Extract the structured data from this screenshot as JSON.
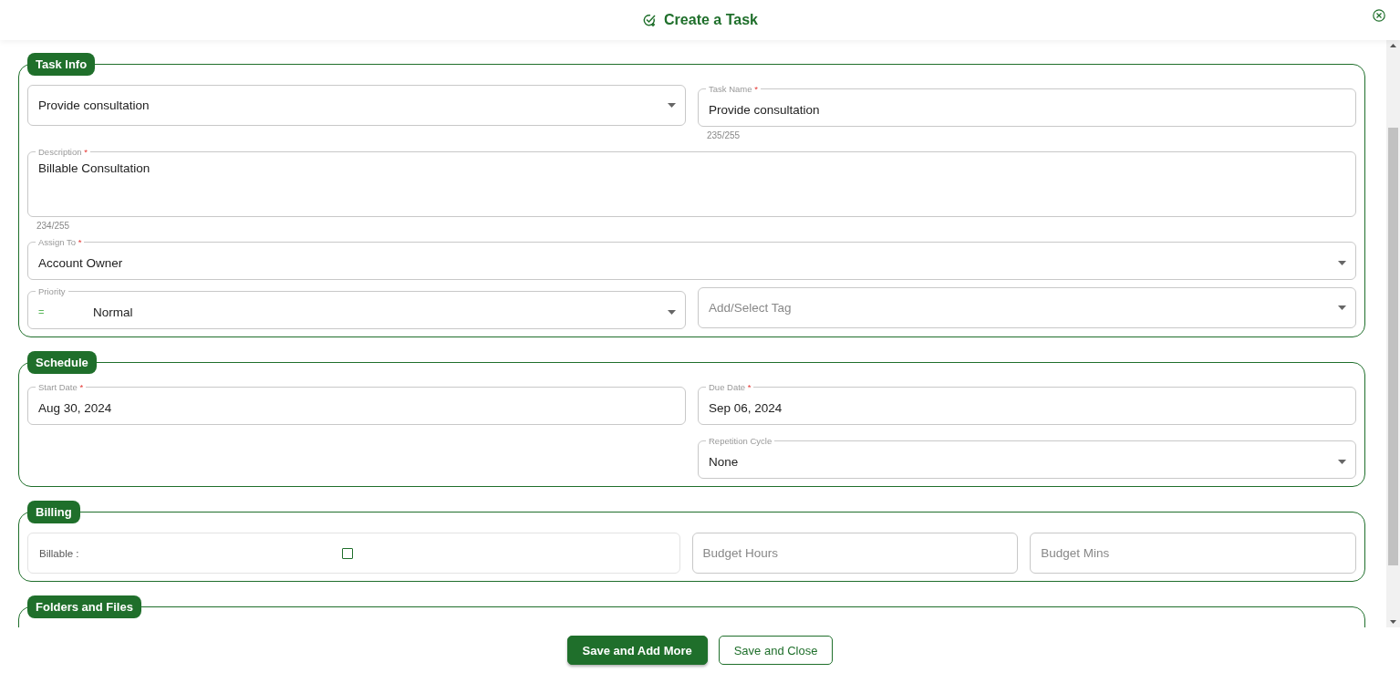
{
  "header": {
    "title": "Create a Task"
  },
  "sections": [
    {
      "title": "Task Info",
      "rows": [
        {
          "fields": [
            {
              "kind": "select",
              "value": "Provide consultation"
            },
            {
              "kind": "text",
              "label": "Task Name",
              "required_mark": "*",
              "value": "Provide consultation",
              "helper": "235/255"
            }
          ]
        },
        {
          "fields": [
            {
              "kind": "textarea",
              "label": "Description",
              "required_mark": "*",
              "value": "Billable Consultation",
              "helper": "234/255"
            }
          ]
        },
        {
          "fields": [
            {
              "kind": "select",
              "label": "Assign To",
              "required_mark": "*",
              "value": "Account Owner"
            }
          ]
        },
        {
          "fields": [
            {
              "kind": "select",
              "label": "Priority",
              "icon": "=",
              "value": "Normal"
            },
            {
              "kind": "select",
              "placeholder": "Add/Select Tag"
            }
          ]
        }
      ]
    },
    {
      "title": "Schedule",
      "columns": [
        [
          {
            "kind": "text",
            "label": "Start Date",
            "required_mark": "*",
            "value": "Aug 30, 2024"
          }
        ],
        [
          {
            "kind": "text",
            "label": "Due Date",
            "required_mark": "*",
            "value": "Sep 06, 2024"
          },
          {
            "kind": "select",
            "label": "Repetition Cycle",
            "value": "None"
          }
        ]
      ]
    },
    {
      "title": "Billing",
      "rows": [
        {
          "fields": [
            {
              "kind": "checkbox",
              "label": "Billable :",
              "checked": false
            },
            {
              "kind": "text",
              "placeholder": "Budget Hours"
            },
            {
              "kind": "text",
              "placeholder": "Budget Mins"
            }
          ]
        }
      ]
    },
    {
      "title": "Folders and Files"
    }
  ],
  "buttons": [
    {
      "kind": "primary",
      "label": "Save and Add More"
    },
    {
      "kind": "secondary",
      "label": "Save and Close"
    }
  ]
}
